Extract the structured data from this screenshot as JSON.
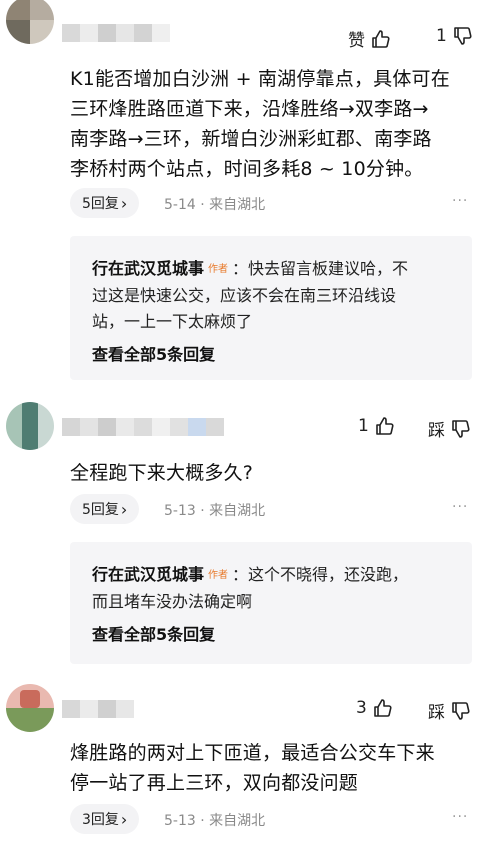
{
  "comments": [
    {
      "like_label": "赞",
      "dislike_count": "1",
      "text_lines": [
        "K1能否增加白沙洲 + 南湖停靠点，具体可在",
        "三环烽胜路匝道下来，沿烽胜络→双李路→",
        "南李路→三环，新增白沙洲彩虹郡、南李路",
        "李桥村两个站点，时间多耗8 ~ 10分钟。"
      ],
      "reply_count": "5回复",
      "date": "5-14",
      "location": "来自湖北",
      "reply": {
        "author": "行在武汉觅城事",
        "badge": "作者",
        "text_lines": [
          "：快去留言板建议哈，不",
          "过这是快速公交，应该不会在南三环沿线设",
          "站，一上一下太麻烦了"
        ],
        "view_all": "查看全部5条回复"
      }
    },
    {
      "like_count": "1",
      "dislike_label": "踩",
      "text_lines": [
        "全程跑下来大概多久?"
      ],
      "reply_count": "5回复",
      "date": "5-13",
      "location": "来自湖北",
      "reply": {
        "author": "行在武汉觅城事",
        "badge": "作者",
        "text_lines": [
          "：这个不晓得，还没跑，",
          "而且堵车没办法确定啊"
        ],
        "view_all": "查看全部5条回复"
      }
    },
    {
      "like_count": "3",
      "dislike_label": "踩",
      "text_lines": [
        "烽胜路的两对上下匝道，最适合公交车下来",
        "停一站了再上三环，双向都没问题"
      ],
      "reply_count": "3回复",
      "date": "5-13",
      "location": "来自湖北"
    }
  ],
  "more_label": "···",
  "chevron": "›",
  "meta_separator": "·",
  "icons": [
    "thumb-up-icon",
    "thumb-down-icon",
    "chevron-right-icon",
    "more-icon"
  ]
}
